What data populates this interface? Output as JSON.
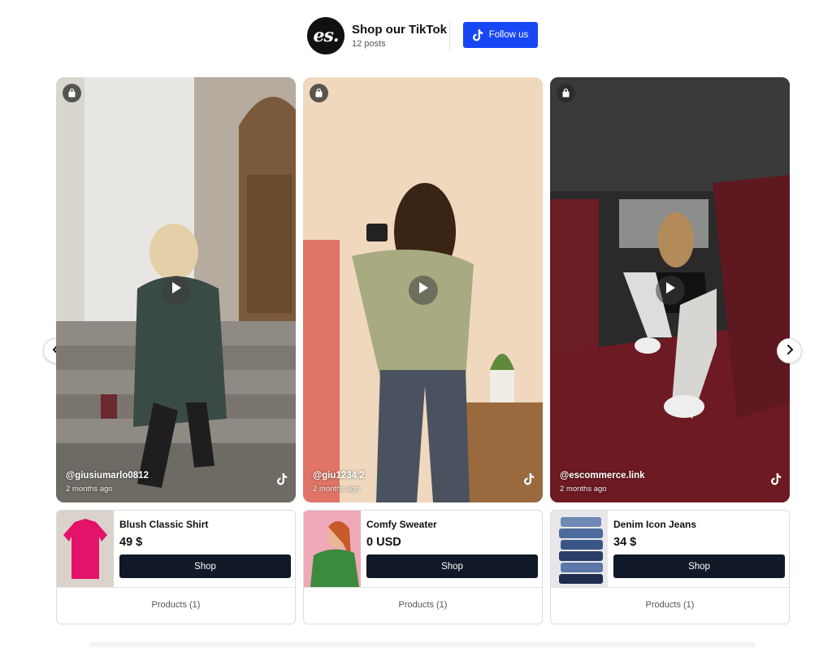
{
  "header": {
    "logo_text": "es.",
    "title": "Shop our TikTok",
    "posts_count": "12 posts",
    "follow_label": "Follow us",
    "follow_color": "#1747f5"
  },
  "posts": [
    {
      "handle": "@giusiumarlo0812",
      "time_ago": "2 months ago"
    },
    {
      "handle": "@giu1234.2",
      "time_ago": "2 months ago"
    },
    {
      "handle": "@escommerce.link",
      "time_ago": "2 months ago"
    }
  ],
  "products": [
    {
      "name": "Blush Classic Shirt",
      "price": "49 $",
      "shop_label": "Shop",
      "count_label": "Products (1)"
    },
    {
      "name": "Comfy Sweater",
      "price": "0 USD",
      "shop_label": "Shop",
      "count_label": "Products (1)"
    },
    {
      "name": "Denim Icon Jeans",
      "price": "34 $",
      "shop_label": "Shop",
      "count_label": "Products (1)"
    }
  ],
  "icons": {
    "logo": "brand-logo",
    "follow": "tiktok-icon",
    "bag": "shopping-bag-icon",
    "play": "play-icon",
    "prev": "chevron-left-icon",
    "next": "chevron-right-icon"
  },
  "colors": {
    "shop_button": "#111827",
    "text_primary": "#111111",
    "border": "#dcdcdc"
  }
}
